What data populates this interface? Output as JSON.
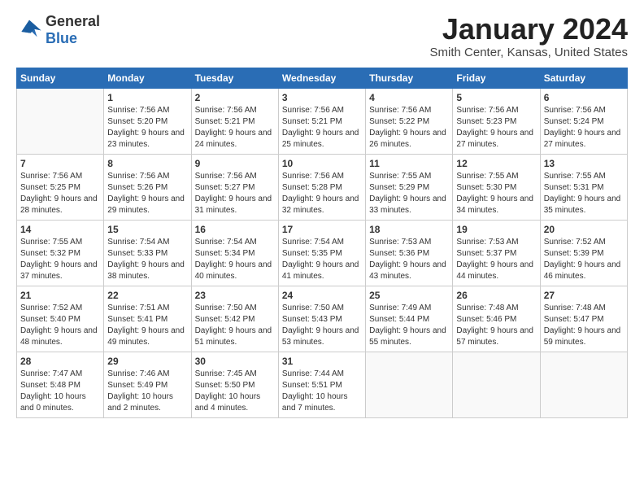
{
  "header": {
    "logo_general": "General",
    "logo_blue": "Blue",
    "title": "January 2024",
    "location": "Smith Center, Kansas, United States"
  },
  "days_of_week": [
    "Sunday",
    "Monday",
    "Tuesday",
    "Wednesday",
    "Thursday",
    "Friday",
    "Saturday"
  ],
  "weeks": [
    [
      {
        "day": "",
        "sunrise": "",
        "sunset": "",
        "daylight": "",
        "empty": true
      },
      {
        "day": "1",
        "sunrise": "7:56 AM",
        "sunset": "5:20 PM",
        "daylight": "9 hours and 23 minutes."
      },
      {
        "day": "2",
        "sunrise": "7:56 AM",
        "sunset": "5:21 PM",
        "daylight": "9 hours and 24 minutes."
      },
      {
        "day": "3",
        "sunrise": "7:56 AM",
        "sunset": "5:21 PM",
        "daylight": "9 hours and 25 minutes."
      },
      {
        "day": "4",
        "sunrise": "7:56 AM",
        "sunset": "5:22 PM",
        "daylight": "9 hours and 26 minutes."
      },
      {
        "day": "5",
        "sunrise": "7:56 AM",
        "sunset": "5:23 PM",
        "daylight": "9 hours and 27 minutes."
      },
      {
        "day": "6",
        "sunrise": "7:56 AM",
        "sunset": "5:24 PM",
        "daylight": "9 hours and 27 minutes."
      }
    ],
    [
      {
        "day": "7",
        "sunrise": "7:56 AM",
        "sunset": "5:25 PM",
        "daylight": "9 hours and 28 minutes."
      },
      {
        "day": "8",
        "sunrise": "7:56 AM",
        "sunset": "5:26 PM",
        "daylight": "9 hours and 29 minutes."
      },
      {
        "day": "9",
        "sunrise": "7:56 AM",
        "sunset": "5:27 PM",
        "daylight": "9 hours and 31 minutes."
      },
      {
        "day": "10",
        "sunrise": "7:56 AM",
        "sunset": "5:28 PM",
        "daylight": "9 hours and 32 minutes."
      },
      {
        "day": "11",
        "sunrise": "7:55 AM",
        "sunset": "5:29 PM",
        "daylight": "9 hours and 33 minutes."
      },
      {
        "day": "12",
        "sunrise": "7:55 AM",
        "sunset": "5:30 PM",
        "daylight": "9 hours and 34 minutes."
      },
      {
        "day": "13",
        "sunrise": "7:55 AM",
        "sunset": "5:31 PM",
        "daylight": "9 hours and 35 minutes."
      }
    ],
    [
      {
        "day": "14",
        "sunrise": "7:55 AM",
        "sunset": "5:32 PM",
        "daylight": "9 hours and 37 minutes."
      },
      {
        "day": "15",
        "sunrise": "7:54 AM",
        "sunset": "5:33 PM",
        "daylight": "9 hours and 38 minutes."
      },
      {
        "day": "16",
        "sunrise": "7:54 AM",
        "sunset": "5:34 PM",
        "daylight": "9 hours and 40 minutes."
      },
      {
        "day": "17",
        "sunrise": "7:54 AM",
        "sunset": "5:35 PM",
        "daylight": "9 hours and 41 minutes."
      },
      {
        "day": "18",
        "sunrise": "7:53 AM",
        "sunset": "5:36 PM",
        "daylight": "9 hours and 43 minutes."
      },
      {
        "day": "19",
        "sunrise": "7:53 AM",
        "sunset": "5:37 PM",
        "daylight": "9 hours and 44 minutes."
      },
      {
        "day": "20",
        "sunrise": "7:52 AM",
        "sunset": "5:39 PM",
        "daylight": "9 hours and 46 minutes."
      }
    ],
    [
      {
        "day": "21",
        "sunrise": "7:52 AM",
        "sunset": "5:40 PM",
        "daylight": "9 hours and 48 minutes."
      },
      {
        "day": "22",
        "sunrise": "7:51 AM",
        "sunset": "5:41 PM",
        "daylight": "9 hours and 49 minutes."
      },
      {
        "day": "23",
        "sunrise": "7:50 AM",
        "sunset": "5:42 PM",
        "daylight": "9 hours and 51 minutes."
      },
      {
        "day": "24",
        "sunrise": "7:50 AM",
        "sunset": "5:43 PM",
        "daylight": "9 hours and 53 minutes."
      },
      {
        "day": "25",
        "sunrise": "7:49 AM",
        "sunset": "5:44 PM",
        "daylight": "9 hours and 55 minutes."
      },
      {
        "day": "26",
        "sunrise": "7:48 AM",
        "sunset": "5:46 PM",
        "daylight": "9 hours and 57 minutes."
      },
      {
        "day": "27",
        "sunrise": "7:48 AM",
        "sunset": "5:47 PM",
        "daylight": "9 hours and 59 minutes."
      }
    ],
    [
      {
        "day": "28",
        "sunrise": "7:47 AM",
        "sunset": "5:48 PM",
        "daylight": "10 hours and 0 minutes."
      },
      {
        "day": "29",
        "sunrise": "7:46 AM",
        "sunset": "5:49 PM",
        "daylight": "10 hours and 2 minutes."
      },
      {
        "day": "30",
        "sunrise": "7:45 AM",
        "sunset": "5:50 PM",
        "daylight": "10 hours and 4 minutes."
      },
      {
        "day": "31",
        "sunrise": "7:44 AM",
        "sunset": "5:51 PM",
        "daylight": "10 hours and 7 minutes."
      },
      {
        "day": "",
        "sunrise": "",
        "sunset": "",
        "daylight": "",
        "empty": true
      },
      {
        "day": "",
        "sunrise": "",
        "sunset": "",
        "daylight": "",
        "empty": true
      },
      {
        "day": "",
        "sunrise": "",
        "sunset": "",
        "daylight": "",
        "empty": true
      }
    ]
  ]
}
